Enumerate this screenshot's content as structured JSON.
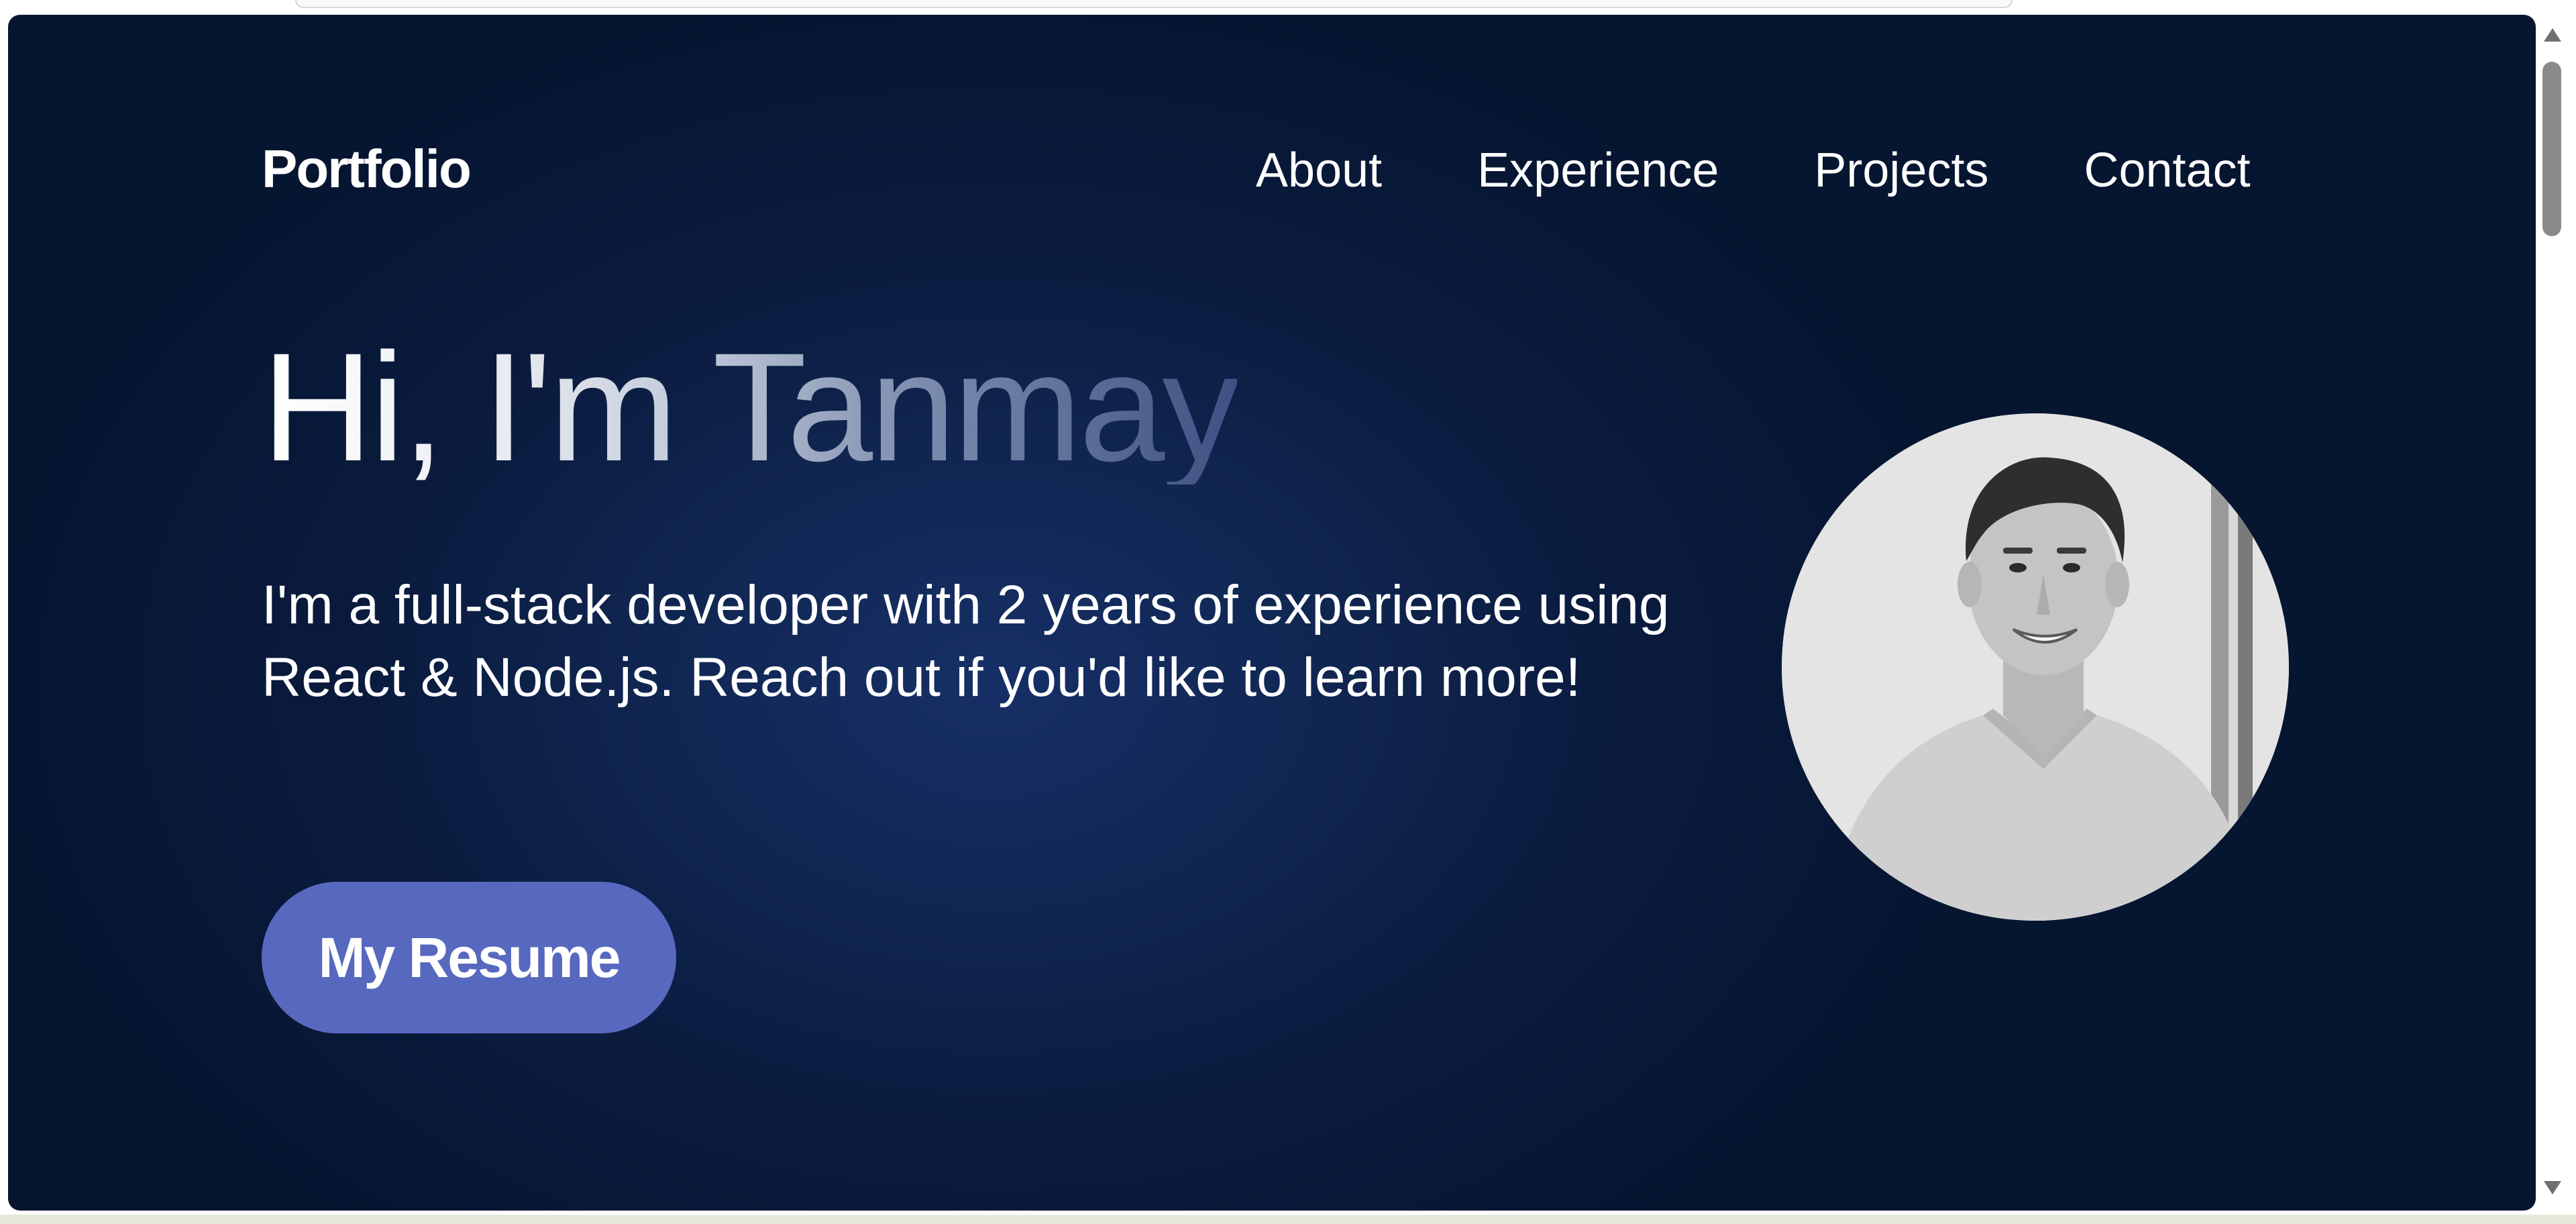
{
  "nav": {
    "logo": "Portfolio",
    "links": [
      "About",
      "Experience",
      "Projects",
      "Contact"
    ]
  },
  "hero": {
    "title": "Hi, I'm Tanmay",
    "description": "I'm a full-stack developer with 2 years of experience using React & Node.js. Reach out if you'd like to learn more!",
    "resume_button": "My Resume"
  },
  "avatar": {
    "icon": "profile-photo"
  },
  "colors": {
    "background": "#0a1b3e",
    "button": "#5768bf",
    "text": "#ffffff"
  }
}
